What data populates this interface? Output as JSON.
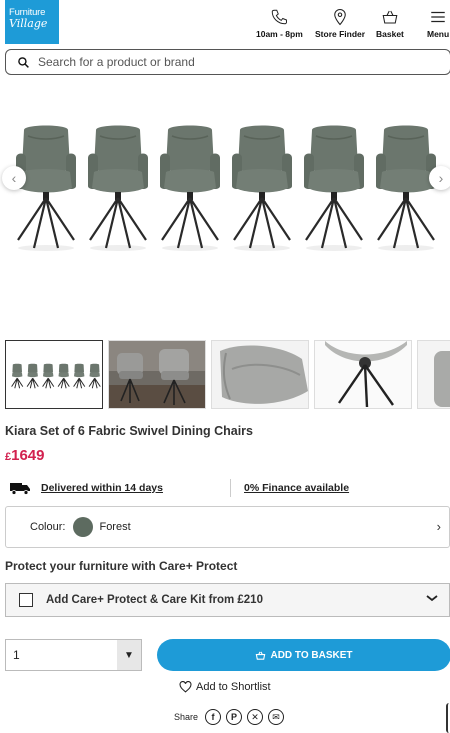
{
  "header": {
    "logo_line1": "Furniture",
    "logo_line2": "Village",
    "nav": [
      {
        "label": "10am - 8pm",
        "icon": "phone-icon"
      },
      {
        "label": "Store Finder",
        "icon": "location-pin-icon"
      },
      {
        "label": "Basket",
        "icon": "basket-icon"
      },
      {
        "label": "Menu",
        "icon": "hamburger-icon"
      }
    ]
  },
  "search": {
    "placeholder": "Search for a product or brand"
  },
  "gallery": {
    "main_image": "Six grey fabric swivel dining chairs with black metal legs",
    "thumbnails": [
      "Set of 6 chairs",
      "Two chairs in room setting",
      "Seat close-up",
      "Leg close-up",
      "Fabric detail"
    ],
    "active_index": 0
  },
  "product": {
    "title": "Kiara Set of 6 Fabric Swivel Dining Chairs",
    "currency": "£",
    "price": "1649",
    "delivery_link": "Delivered within 14 days",
    "finance_link": "0% Finance available"
  },
  "colour": {
    "label": "Colour:",
    "value": "Forest",
    "swatch": "#5d6b60"
  },
  "care": {
    "heading": "Protect your furniture with Care+ Protect",
    "option_label": "Add Care+ Protect & Care Kit from £210"
  },
  "purchase": {
    "quantity": "1",
    "add_button_label": "ADD TO BASKET",
    "shortlist_label": "Add to Shortlist",
    "share_label": "Share"
  },
  "colors": {
    "accent": "#1e9bd7",
    "price": "#d2214f"
  }
}
